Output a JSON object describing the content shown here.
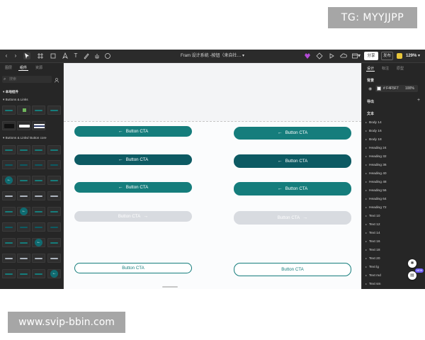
{
  "watermarks": {
    "top": "TG: MYYJJPP",
    "bottom": "www.svip-bbin.com"
  },
  "toolbar": {
    "title": "Fram 设计系统 -按钮（来自社…",
    "share_label": "分享",
    "publish_label": "发布",
    "zoom": "129%"
  },
  "left_panel": {
    "tabs": [
      "图层",
      "组件",
      "资源"
    ],
    "search_placeholder": "搜索",
    "section_local": "本地组件",
    "group_buttons": "Buttons & Links",
    "group_core": "Buttons & Links/ Button core"
  },
  "canvas": {
    "buttons": [
      {
        "label": "Button CTA",
        "variant": "teal",
        "icon": "arrow-left"
      },
      {
        "label": "Button CTA",
        "variant": "dark",
        "icon": "arrow-left"
      },
      {
        "label": "Button CTA",
        "variant": "teal",
        "icon": "arrow-left"
      },
      {
        "label": "Button CTA",
        "variant": "disabled",
        "icon": "arrow-right"
      },
      {
        "label": "Button CTA",
        "variant": "outline",
        "icon": "none"
      }
    ],
    "colors": {
      "teal": "#157d7c",
      "dark": "#0d5a63",
      "disabled": "#d8dbe0",
      "background": "#fbfcfd"
    }
  },
  "right_panel": {
    "tabs": [
      "设计",
      "标注",
      "原型"
    ],
    "background_heading": "背景",
    "background_hex": "F4F5F7",
    "background_opacity": "100%",
    "export_heading": "导出",
    "text_heading": "文本",
    "text_styles": [
      "Body 14",
      "Body 16",
      "Body 18",
      "Heading 24",
      "Heading 32",
      "Heading 36",
      "Heading 40",
      "Heading 48",
      "Heading 56",
      "Heading 64",
      "Heading 72",
      "Text 10",
      "Text 12",
      "Text 14",
      "Text 16",
      "Text 18",
      "Text 20",
      "Text lg",
      "Text md",
      "Text sm"
    ],
    "new_badge": "NEW"
  }
}
